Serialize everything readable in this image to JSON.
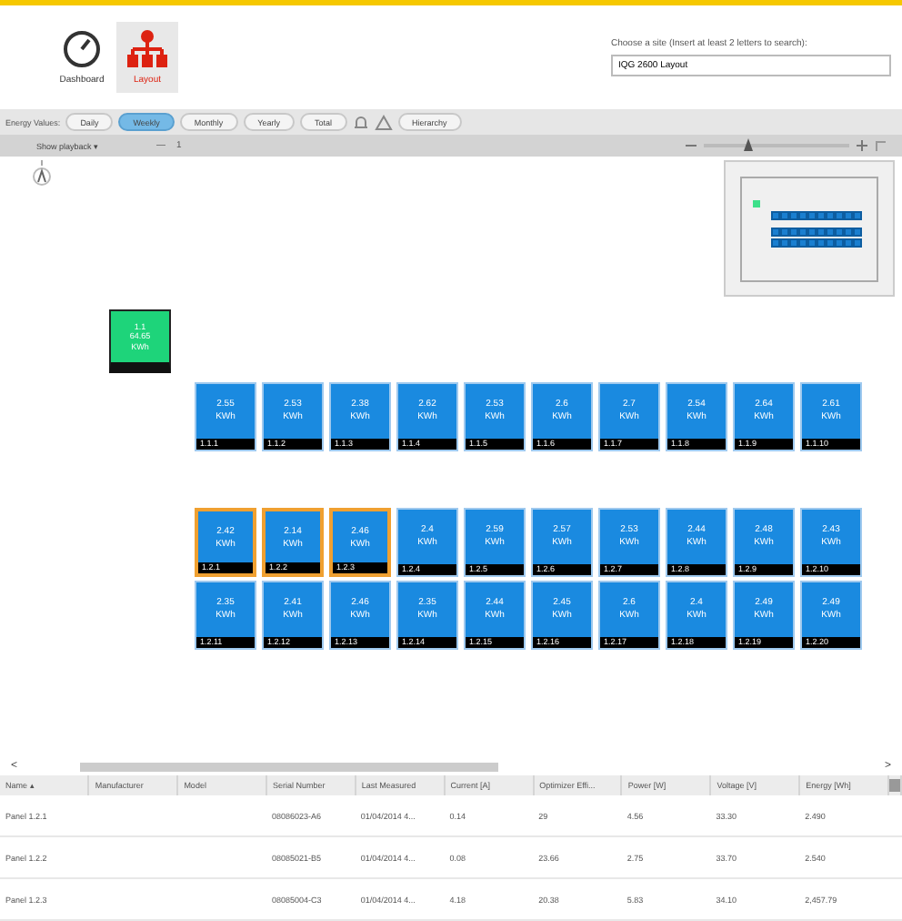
{
  "nav": [
    {
      "label": "Dashboard",
      "kind": "gauge",
      "selected": false
    },
    {
      "label": "Layout",
      "kind": "hierarchy",
      "selected": true
    }
  ],
  "site_search": {
    "label": "Choose a site (Insert at least 2 letters to search):",
    "value": "IQG 2600 Layout"
  },
  "energy_toolbar": {
    "label": "Energy Values:",
    "periods": [
      {
        "label": "Daily",
        "selected": false
      },
      {
        "label": "Weekly",
        "selected": true
      },
      {
        "label": "Monthly",
        "selected": false
      },
      {
        "label": "Yearly",
        "selected": false
      },
      {
        "label": "Total",
        "selected": false
      }
    ],
    "hierarchy_button": "Hierarchy"
  },
  "playback_bar": {
    "dropdown": "Show playback ▾",
    "step_minus": "—",
    "step_value": "1",
    "level": 0.3
  },
  "inverter": {
    "lines": [
      "1.1",
      "64.65",
      "KWh"
    ]
  },
  "panel_rows": [
    [
      {
        "value": "2.55",
        "unit": "KWh",
        "label": "1.1.1",
        "selected": false
      },
      {
        "value": "2.53",
        "unit": "KWh",
        "label": "1.1.2",
        "selected": false
      },
      {
        "value": "2.38",
        "unit": "KWh",
        "label": "1.1.3",
        "selected": false
      },
      {
        "value": "2.62",
        "unit": "KWh",
        "label": "1.1.4",
        "selected": false
      },
      {
        "value": "2.53",
        "unit": "KWh",
        "label": "1.1.5",
        "selected": false
      },
      {
        "value": "2.6",
        "unit": "KWh",
        "label": "1.1.6",
        "selected": false
      },
      {
        "value": "2.7",
        "unit": "KWh",
        "label": "1.1.7",
        "selected": false
      },
      {
        "value": "2.54",
        "unit": "KWh",
        "label": "1.1.8",
        "selected": false
      },
      {
        "value": "2.64",
        "unit": "KWh",
        "label": "1.1.9",
        "selected": false
      },
      {
        "value": "2.61",
        "unit": "KWh",
        "label": "1.1.10",
        "selected": false
      }
    ],
    [
      {
        "value": "2.42",
        "unit": "KWh",
        "label": "1.2.1",
        "selected": true
      },
      {
        "value": "2.14",
        "unit": "KWh",
        "label": "1.2.2",
        "selected": true
      },
      {
        "value": "2.46",
        "unit": "KWh",
        "label": "1.2.3",
        "selected": true
      },
      {
        "value": "2.4",
        "unit": "KWh",
        "label": "1.2.4",
        "selected": false
      },
      {
        "value": "2.59",
        "unit": "KWh",
        "label": "1.2.5",
        "selected": false
      },
      {
        "value": "2.57",
        "unit": "KWh",
        "label": "1.2.6",
        "selected": false
      },
      {
        "value": "2.53",
        "unit": "KWh",
        "label": "1.2.7",
        "selected": false
      },
      {
        "value": "2.44",
        "unit": "KWh",
        "label": "1.2.8",
        "selected": false
      },
      {
        "value": "2.48",
        "unit": "KWh",
        "label": "1.2.9",
        "selected": false
      },
      {
        "value": "2.43",
        "unit": "KWh",
        "label": "1.2.10",
        "selected": false
      }
    ],
    [
      {
        "value": "2.35",
        "unit": "KWh",
        "label": "1.2.11",
        "selected": false
      },
      {
        "value": "2.41",
        "unit": "KWh",
        "label": "1.2.12",
        "selected": false
      },
      {
        "value": "2.46",
        "unit": "KWh",
        "label": "1.2.13",
        "selected": false
      },
      {
        "value": "2.35",
        "unit": "KWh",
        "label": "1.2.14",
        "selected": false
      },
      {
        "value": "2.44",
        "unit": "KWh",
        "label": "1.2.15",
        "selected": false
      },
      {
        "value": "2.45",
        "unit": "KWh",
        "label": "1.2.16",
        "selected": false
      },
      {
        "value": "2.6",
        "unit": "KWh",
        "label": "1.2.17",
        "selected": false
      },
      {
        "value": "2.4",
        "unit": "KWh",
        "label": "1.2.18",
        "selected": false
      },
      {
        "value": "2.49",
        "unit": "KWh",
        "label": "1.2.19",
        "selected": false
      },
      {
        "value": "2.49",
        "unit": "KWh",
        "label": "1.2.20",
        "selected": false
      }
    ]
  ],
  "scroll_arrows": [
    "<",
    ">"
  ],
  "table": {
    "columns": [
      "Name ▴",
      "Manufacturer",
      "Model",
      "Serial Number",
      "Last Measured",
      "Current [A]",
      "Optimizer Effi...",
      "Power [W]",
      "Voltage [V]",
      "Energy [Wh]"
    ],
    "rows": [
      [
        "Panel 1.2.1",
        null,
        null,
        "08086023-A6",
        "01/04/2014 4...",
        "0.14",
        "29",
        "4.56",
        "33.30",
        "2.490"
      ],
      [
        "Panel 1.2.2",
        null,
        null,
        "08085021-B5",
        "01/04/2014 4...",
        "0.08",
        "23.66",
        "2.75",
        "33.70",
        "2.540"
      ],
      [
        "Panel 1.2.3",
        null,
        null,
        "08085004-C3",
        "01/04/2014 4...",
        "4.18",
        "20.38",
        "5.83",
        "34.10",
        "2,457.79"
      ]
    ]
  }
}
